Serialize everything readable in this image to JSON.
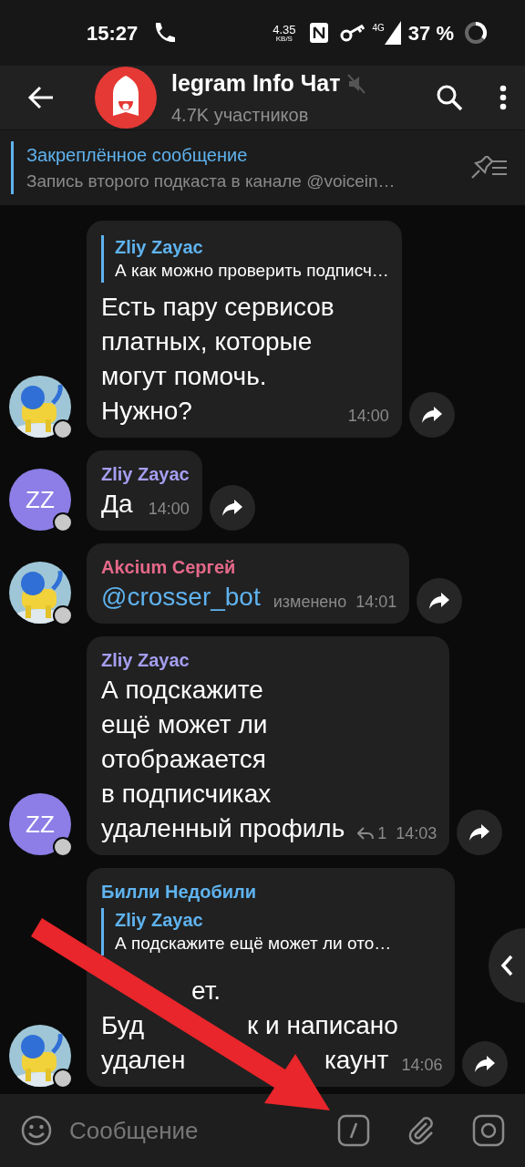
{
  "status_bar": {
    "time": "15:27",
    "speed": "4.35",
    "speed_unit": "KB/S",
    "network": "4G",
    "battery": "37 %"
  },
  "header": {
    "title": "legram Info Чат",
    "muted": true,
    "subtitle": "4.7K участников"
  },
  "pinned": {
    "title": "Закреплённое сообщение",
    "text": "Запись второго подкаста в канале @voicein…"
  },
  "messages": [
    {
      "avatar": {
        "kind": "picture"
      },
      "reply": {
        "author": "Zliy Zayac",
        "text": "А как можно проверить подписч…"
      },
      "kind": "text",
      "text": "Есть пару сервисов\nплатных, которые\nмогут помочь.\nНужно?",
      "time": "14:00"
    },
    {
      "author": "Zliy Zayac",
      "color": "#a59ef0",
      "avatar": {
        "kind": "initials",
        "initials": "ZZ",
        "color": "#8c7ee6"
      },
      "kind": "text",
      "text": "Да",
      "time": "14:00"
    },
    {
      "author": "Akcium Сергей",
      "color": "#e5698a",
      "avatar": {
        "kind": "picture"
      },
      "kind": "link",
      "text": "@crosser_bot",
      "edited": "изменено",
      "time": "14:01"
    },
    {
      "author": "Zliy Zayac",
      "color": "#a59ef0",
      "avatar": {
        "kind": "initials",
        "initials": "ZZ",
        "color": "#8c7ee6"
      },
      "kind": "text",
      "text": "А подскажите\nещё может ли\nотображается\nв подписчиках\nудаленный профиль",
      "replies": "1",
      "time": "14:03"
    },
    {
      "author": "Билли Недобили",
      "color": "#5fb3ef",
      "avatar": {
        "kind": "picture"
      },
      "reply": {
        "author": "Zliy Zayac",
        "text": "А подскажите ещё может ли ото…"
      },
      "kind": "covered",
      "lines": [
        [
          "ет."
        ],
        [
          "Буд",
          "к и написано"
        ],
        [
          "удален",
          "каунт"
        ]
      ],
      "time": "14:06"
    }
  ],
  "composer": {
    "placeholder": "Сообщение"
  }
}
